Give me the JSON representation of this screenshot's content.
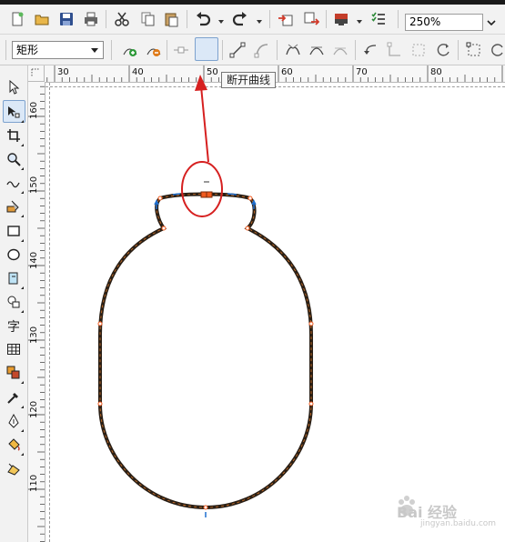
{
  "toolbar": {
    "zoom_value": "250%",
    "shape_type": "矩形",
    "tooltip": "断开曲线"
  },
  "ruler": {
    "horizontal_labels": [
      "30",
      "40",
      "50",
      "60",
      "70",
      "80"
    ],
    "vertical_labels": [
      "160",
      "150",
      "140",
      "130",
      "120",
      "110"
    ]
  },
  "icons": {
    "toolbar_row1": [
      "new-document-icon",
      "open-icon",
      "save-icon",
      "print-icon",
      "cut-icon",
      "copy-icon",
      "paste-icon",
      "undo-icon",
      "redo-icon",
      "import-icon",
      "export-icon",
      "app-launcher-icon",
      "options-icon"
    ],
    "toolbar_row2": [
      "add-node-icon",
      "delete-node-icon",
      "join-nodes-icon",
      "break-curve-icon",
      "to-line-icon",
      "to-curve-icon",
      "cusp-node-icon",
      "smooth-node-icon",
      "symmetric-node-icon",
      "reverse-direction-icon",
      "extend-curve-icon",
      "extract-subpath-icon",
      "auto-close-icon",
      "rotate-nodes-icon"
    ],
    "toolbox": [
      "pick-tool-icon",
      "shape-tool-icon",
      "crop-tool-icon",
      "zoom-tool-icon",
      "freehand-tool-icon",
      "smart-fill-icon",
      "rectangle-tool-icon",
      "ellipse-tool-icon",
      "polygon-tool-icon",
      "basic-shapes-icon",
      "text-tool-icon",
      "table-tool-icon",
      "interactive-tool-icon",
      "eyedropper-icon",
      "outline-pen-icon",
      "fill-tool-icon",
      "interactive-fill-icon"
    ]
  },
  "colors": {
    "annotation_red": "#d62020",
    "node_orange": "#f05a1e",
    "handle_blue": "#1f6fcf",
    "shape_outline": "#2a1f15"
  },
  "watermark": {
    "brand": "Bai 经验",
    "url": "jingyan.baidu.com"
  }
}
